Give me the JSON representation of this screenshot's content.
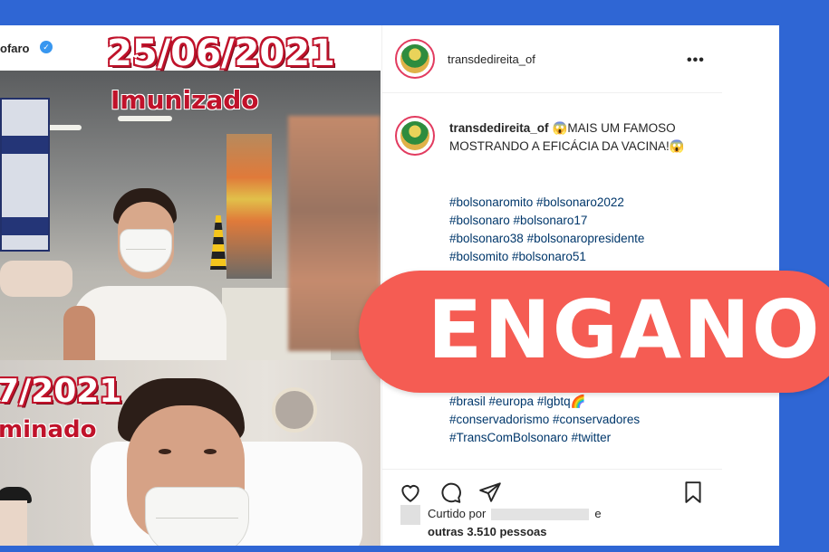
{
  "photo_post": {
    "owner_name": "ofaro",
    "top_date": "25/06/2021",
    "top_status": "Imunizado",
    "bottom_date": "7/2021",
    "bottom_status": "minado"
  },
  "post": {
    "header_username": "transdedireita_of",
    "caption_username": "transdedireita_of",
    "caption_text": "😱MAIS UM FAMOSO MOSTRANDO A EFICÁCIA DA VACINA!😱",
    "hashtags_top": [
      "#bolsonaromito #bolsonaro2022",
      "#bolsonaro #bolsonaro17",
      "#bolsonaro38 #bolsonaropresidente",
      "#bolsomito #bolsonaro51"
    ],
    "hashtags_bottom": [
      "#brasil #europa #lgbtq🌈",
      "#conservadorismo #conservadores",
      "#TransComBolsonaro #twitter"
    ],
    "liked_by_prefix": "Curtido por",
    "liked_by_suffix": "e",
    "others_line": "outras 3.510 pessoas"
  },
  "icons": {
    "more": "more-options-icon",
    "like": "heart-icon",
    "comment": "comment-icon",
    "share": "share-icon",
    "save": "bookmark-icon",
    "verified": "verified-badge-icon"
  },
  "verdict": {
    "label": "ENGANO",
    "color": "#f55c53"
  },
  "colors": {
    "background": "#2f66d4",
    "hashtag": "#00376b",
    "date_outline": "#c0122a"
  }
}
